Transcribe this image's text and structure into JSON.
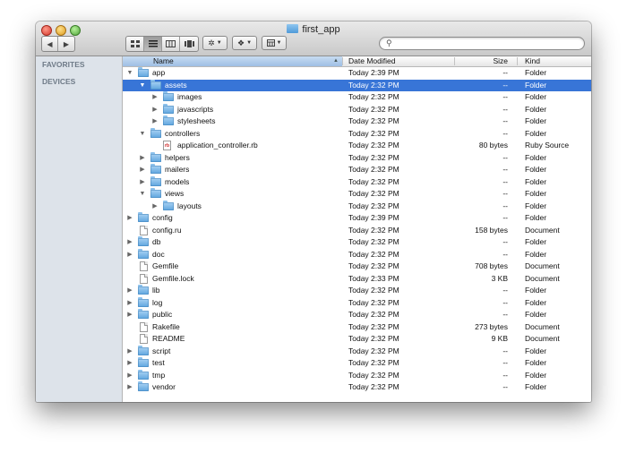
{
  "window": {
    "title": "first_app"
  },
  "toolbar": {
    "back_glyph": "◀",
    "forward_glyph": "▶",
    "view_icons": [
      "icon-view-icon",
      "list-view-icon",
      "column-view-icon",
      "coverflow-view-icon"
    ],
    "action_icon": "gear-icon",
    "dropbox_icon": "dropbox-icon",
    "arrange_icon": "arrange-icon",
    "search": {
      "value": "",
      "placeholder": ""
    }
  },
  "sidebar": {
    "sections": [
      "FAVORITES",
      "DEVICES"
    ]
  },
  "columns": {
    "name": "Name",
    "date": "Date Modified",
    "size": "Size",
    "kind": "Kind"
  },
  "colors": {
    "selection": "#3875d7",
    "sidebar_bg": "#dde3ea",
    "folder": "#5ea5de"
  },
  "rows": [
    {
      "name": "app",
      "depth": 0,
      "disclosure": "open",
      "icon": "folder-icon",
      "date": "Today 2:39 PM",
      "size": "--",
      "kind": "Folder",
      "selected": false
    },
    {
      "name": "assets",
      "depth": 1,
      "disclosure": "open",
      "icon": "folder-icon",
      "date": "Today 2:32 PM",
      "size": "--",
      "kind": "Folder",
      "selected": true
    },
    {
      "name": "images",
      "depth": 2,
      "disclosure": "closed",
      "icon": "folder-icon",
      "date": "Today 2:32 PM",
      "size": "--",
      "kind": "Folder",
      "selected": false
    },
    {
      "name": "javascripts",
      "depth": 2,
      "disclosure": "closed",
      "icon": "folder-icon",
      "date": "Today 2:32 PM",
      "size": "--",
      "kind": "Folder",
      "selected": false
    },
    {
      "name": "stylesheets",
      "depth": 2,
      "disclosure": "closed",
      "icon": "folder-icon",
      "date": "Today 2:32 PM",
      "size": "--",
      "kind": "Folder",
      "selected": false
    },
    {
      "name": "controllers",
      "depth": 1,
      "disclosure": "open",
      "icon": "folder-icon",
      "date": "Today 2:32 PM",
      "size": "--",
      "kind": "Folder",
      "selected": false
    },
    {
      "name": "application_controller.rb",
      "depth": 2,
      "disclosure": "none",
      "icon": "ruby-file-icon",
      "date": "Today 2:32 PM",
      "size": "80 bytes",
      "kind": "Ruby Source",
      "selected": false
    },
    {
      "name": "helpers",
      "depth": 1,
      "disclosure": "closed",
      "icon": "folder-icon",
      "date": "Today 2:32 PM",
      "size": "--",
      "kind": "Folder",
      "selected": false
    },
    {
      "name": "mailers",
      "depth": 1,
      "disclosure": "closed",
      "icon": "folder-icon",
      "date": "Today 2:32 PM",
      "size": "--",
      "kind": "Folder",
      "selected": false
    },
    {
      "name": "models",
      "depth": 1,
      "disclosure": "closed",
      "icon": "folder-icon",
      "date": "Today 2:32 PM",
      "size": "--",
      "kind": "Folder",
      "selected": false
    },
    {
      "name": "views",
      "depth": 1,
      "disclosure": "open",
      "icon": "folder-icon",
      "date": "Today 2:32 PM",
      "size": "--",
      "kind": "Folder",
      "selected": false
    },
    {
      "name": "layouts",
      "depth": 2,
      "disclosure": "closed",
      "icon": "folder-icon",
      "date": "Today 2:32 PM",
      "size": "--",
      "kind": "Folder",
      "selected": false
    },
    {
      "name": "config",
      "depth": 0,
      "disclosure": "closed",
      "icon": "folder-icon",
      "date": "Today 2:39 PM",
      "size": "--",
      "kind": "Folder",
      "selected": false
    },
    {
      "name": "config.ru",
      "depth": 0,
      "disclosure": "none",
      "icon": "document-icon",
      "date": "Today 2:32 PM",
      "size": "158 bytes",
      "kind": "Document",
      "selected": false
    },
    {
      "name": "db",
      "depth": 0,
      "disclosure": "closed",
      "icon": "folder-icon",
      "date": "Today 2:32 PM",
      "size": "--",
      "kind": "Folder",
      "selected": false
    },
    {
      "name": "doc",
      "depth": 0,
      "disclosure": "closed",
      "icon": "folder-icon",
      "date": "Today 2:32 PM",
      "size": "--",
      "kind": "Folder",
      "selected": false
    },
    {
      "name": "Gemfile",
      "depth": 0,
      "disclosure": "none",
      "icon": "document-icon",
      "date": "Today 2:32 PM",
      "size": "708 bytes",
      "kind": "Document",
      "selected": false
    },
    {
      "name": "Gemfile.lock",
      "depth": 0,
      "disclosure": "none",
      "icon": "document-icon",
      "date": "Today 2:33 PM",
      "size": "3 KB",
      "kind": "Document",
      "selected": false
    },
    {
      "name": "lib",
      "depth": 0,
      "disclosure": "closed",
      "icon": "folder-icon",
      "date": "Today 2:32 PM",
      "size": "--",
      "kind": "Folder",
      "selected": false
    },
    {
      "name": "log",
      "depth": 0,
      "disclosure": "closed",
      "icon": "folder-icon",
      "date": "Today 2:32 PM",
      "size": "--",
      "kind": "Folder",
      "selected": false
    },
    {
      "name": "public",
      "depth": 0,
      "disclosure": "closed",
      "icon": "folder-icon",
      "date": "Today 2:32 PM",
      "size": "--",
      "kind": "Folder",
      "selected": false
    },
    {
      "name": "Rakefile",
      "depth": 0,
      "disclosure": "none",
      "icon": "document-icon",
      "date": "Today 2:32 PM",
      "size": "273 bytes",
      "kind": "Document",
      "selected": false
    },
    {
      "name": "README",
      "depth": 0,
      "disclosure": "none",
      "icon": "document-icon",
      "date": "Today 2:32 PM",
      "size": "9 KB",
      "kind": "Document",
      "selected": false
    },
    {
      "name": "script",
      "depth": 0,
      "disclosure": "closed",
      "icon": "folder-icon",
      "date": "Today 2:32 PM",
      "size": "--",
      "kind": "Folder",
      "selected": false
    },
    {
      "name": "test",
      "depth": 0,
      "disclosure": "closed",
      "icon": "folder-icon",
      "date": "Today 2:32 PM",
      "size": "--",
      "kind": "Folder",
      "selected": false
    },
    {
      "name": "tmp",
      "depth": 0,
      "disclosure": "closed",
      "icon": "folder-icon",
      "date": "Today 2:32 PM",
      "size": "--",
      "kind": "Folder",
      "selected": false
    },
    {
      "name": "vendor",
      "depth": 0,
      "disclosure": "closed",
      "icon": "folder-icon",
      "date": "Today 2:32 PM",
      "size": "--",
      "kind": "Folder",
      "selected": false
    }
  ]
}
